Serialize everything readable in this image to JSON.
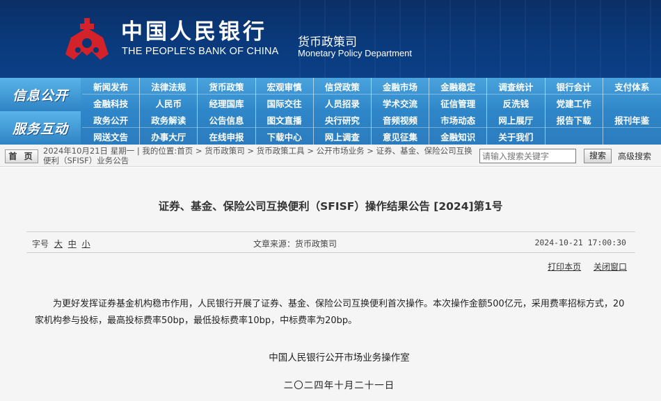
{
  "banner": {
    "cn_name": "中国人民银行",
    "en_name": "THE PEOPLE'S BANK OF CHINA",
    "dept_cn": "货币政策司",
    "dept_en": "Monetary Policy Department",
    "logo_icon": "pboc-emblem-icon",
    "logo_color": "#d3222a"
  },
  "nav": {
    "section1_label": "信息公开",
    "section2_label": "服务互动",
    "row1": [
      "新闻发布",
      "法律法规",
      "货币政策",
      "宏观审慎",
      "信贷政策",
      "金融市场",
      "金融稳定",
      "调查统计",
      "银行会计",
      "支付体系"
    ],
    "row2": [
      "金融科技",
      "人民币",
      "经理国库",
      "国际交往",
      "人员招录",
      "学术交流",
      "征信管理",
      "反洗钱",
      "党建工作",
      ""
    ],
    "row3": [
      "政务公开",
      "政务解读",
      "公告信息",
      "图文直播",
      "央行研究",
      "音频视频",
      "市场动态",
      "网上展厅",
      "报告下载",
      "报刊年鉴"
    ],
    "row4": [
      "网送文告",
      "办事大厅",
      "在线申报",
      "下载中心",
      "网上调查",
      "意见征集",
      "金融知识",
      "关于我们",
      "",
      ""
    ]
  },
  "crumb": {
    "home_label": "首 页",
    "date": "2024年10月21日 星期一",
    "location_prefix": "我的位置:",
    "items": [
      "首页",
      "货币政策司",
      "货币政策工具",
      "公开市场业务",
      "证券、基金、保险公司互换便利（SFISF）业务公告"
    ],
    "separator": ">",
    "search_placeholder": "请输入搜索关键字",
    "search_button": "搜索",
    "advanced_search": "高级搜索"
  },
  "article": {
    "title": "证券、基金、保险公司互换便利（SFISF）操作结果公告 [2024]第1号",
    "font_size_label": "字号",
    "font_sizes": [
      "大",
      "中",
      "小"
    ],
    "source": "文章来源：货币政策司",
    "datetime": "2024-10-21 17:00:30",
    "print_label": "打印本页",
    "close_label": "关闭窗口",
    "body": "为更好发挥证券基金机构稳市作用，人民银行开展了证券、基金、保险公司互换便利首次操作。本次操作金额500亿元，采用费率招标方式，20家机构参与投标，最高投标费率50bp，最低投标费率10bp，中标费率为20bp。",
    "signature": "中国人民银行公开市场业务操作室",
    "sign_date": "二〇二四年十月二十一日"
  }
}
